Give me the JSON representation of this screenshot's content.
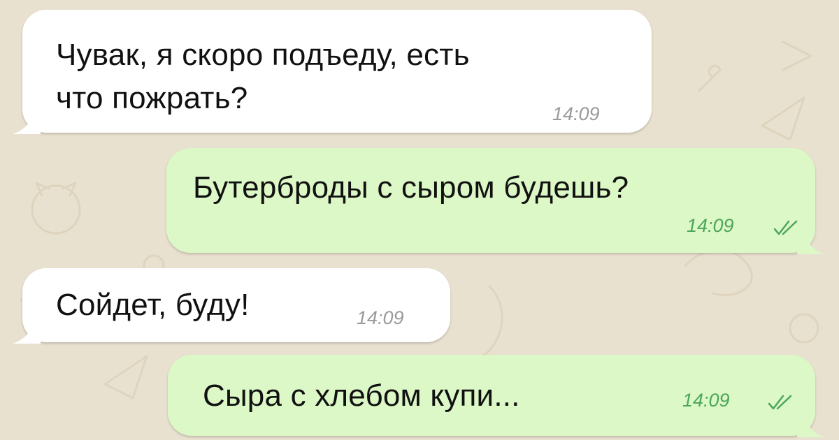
{
  "theme": {
    "background": "#e9e1cf",
    "incoming_bubble": "#ffffff",
    "outgoing_bubble": "#dcf8c6",
    "timestamp_incoming": "#9a9a9a",
    "timestamp_outgoing": "#4ca65a"
  },
  "messages": [
    {
      "direction": "incoming",
      "text": "Чувак, я скоро подъеду, есть\nчто пожрать?",
      "time": "14:09"
    },
    {
      "direction": "outgoing",
      "text": "Бутерброды с сыром будешь?",
      "time": "14:09",
      "status_icon": "double-check-icon"
    },
    {
      "direction": "incoming",
      "text": "Сойдет, буду!",
      "time": "14:09"
    },
    {
      "direction": "outgoing",
      "text": "Сыра с хлебом купи...",
      "time": "14:09",
      "status_icon": "double-check-icon"
    }
  ]
}
